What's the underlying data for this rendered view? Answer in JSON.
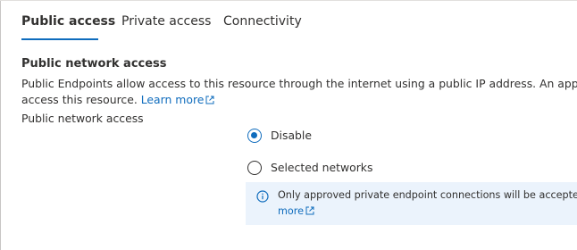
{
  "tabs": [
    {
      "label": "Public access",
      "active": true
    },
    {
      "label": "Private access",
      "active": false
    },
    {
      "label": "Connectivity",
      "active": false
    }
  ],
  "section": {
    "title": "Public network access",
    "description_line1": "Public Endpoints allow access to this resource through the internet using a public IP address. An application o",
    "description_line2": "access this resource. ",
    "learn_more": "Learn more"
  },
  "field": {
    "label": "Public network access",
    "options": [
      {
        "label": "Disable",
        "selected": true
      },
      {
        "label": "Selected networks",
        "selected": false
      }
    ]
  },
  "info": {
    "line1": "Only approved private endpoint connections will be accepted b",
    "line2_link": "more"
  },
  "colors": {
    "accent": "#0f6cbd",
    "info_background": "#ebf3fc",
    "text": "#323130"
  },
  "icons": {
    "external_link": "external-link-icon",
    "info": "info-icon"
  }
}
